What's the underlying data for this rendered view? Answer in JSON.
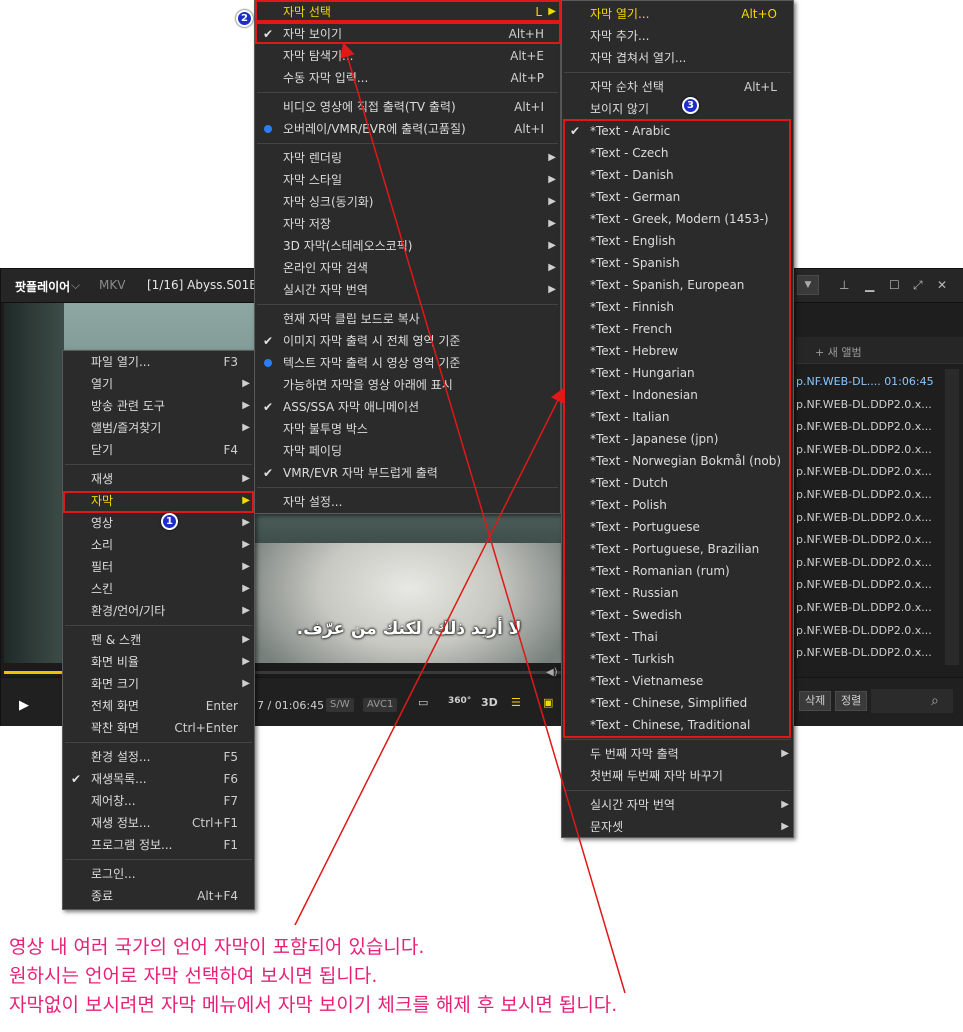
{
  "player": {
    "brand": "팟플레이어",
    "brand_chevron": "⌵",
    "format": "MKV",
    "title": "[1/16] Abyss.S01E0",
    "subtitle_text": "لا أريد ذلك، لكنك من عرّف.",
    "time": "7 / 01:06:45",
    "tags": [
      "S/W",
      "AVC1"
    ],
    "ctrl_icons": [
      "360°",
      "3D"
    ],
    "window_icons": [
      "pin-icon",
      "minimize-icon",
      "maximize-icon",
      "fullscreen-icon",
      "close-icon"
    ],
    "new_album": "+ 새 앨범",
    "playlist_rows": [
      {
        "text": "p.NF.WEB-DL.... 01:06:45",
        "active": true
      },
      {
        "text": "p.NF.WEB-DL.DDP2.0.x..."
      },
      {
        "text": "p.NF.WEB-DL.DDP2.0.x..."
      },
      {
        "text": "p.NF.WEB-DL.DDP2.0.x..."
      },
      {
        "text": "p.NF.WEB-DL.DDP2.0.x..."
      },
      {
        "text": "p.NF.WEB-DL.DDP2.0.x..."
      },
      {
        "text": "p.NF.WEB-DL.DDP2.0.x..."
      },
      {
        "text": "p.NF.WEB-DL.DDP2.0.x..."
      },
      {
        "text": "p.NF.WEB-DL.DDP2.0.x..."
      },
      {
        "text": "p.NF.WEB-DL.DDP2.0.x..."
      },
      {
        "text": "p.NF.WEB-DL.DDP2.0.x..."
      },
      {
        "text": "p.NF.WEB-DL.DDP2.0.x..."
      },
      {
        "text": "p.NF.WEB-DL.DDP2.0.x..."
      }
    ],
    "playlist_buttons": [
      "삭제",
      "정렬"
    ],
    "progress_fraction": 0.076
  },
  "menu1": {
    "items": [
      {
        "label": "파일 열기...",
        "shortcut": "F3"
      },
      {
        "label": "열기",
        "arrow": true
      },
      {
        "label": "방송 관련 도구",
        "arrow": true
      },
      {
        "label": "앨범/즐겨찾기",
        "arrow": true
      },
      {
        "label": "닫기",
        "shortcut": "F4"
      },
      {
        "sep": true
      },
      {
        "label": "재생",
        "arrow": true
      },
      {
        "label": "자막",
        "arrow": true,
        "yellow": true
      },
      {
        "label": "영상",
        "arrow": true
      },
      {
        "label": "소리",
        "arrow": true
      },
      {
        "label": "필터",
        "arrow": true
      },
      {
        "label": "스킨",
        "arrow": true
      },
      {
        "label": "환경/언어/기타",
        "arrow": true
      },
      {
        "sep": true
      },
      {
        "label": "팬 & 스캔",
        "arrow": true
      },
      {
        "label": "화면 비율",
        "arrow": true
      },
      {
        "label": "화면 크기",
        "arrow": true
      },
      {
        "label": "전체 화면",
        "shortcut": "Enter"
      },
      {
        "label": "꽉찬 화면",
        "shortcut": "Ctrl+Enter"
      },
      {
        "sep": true
      },
      {
        "label": "환경 설정...",
        "shortcut": "F5"
      },
      {
        "label": "재생목록...",
        "shortcut": "F6",
        "check": true
      },
      {
        "label": "제어창...",
        "shortcut": "F7"
      },
      {
        "label": "재생 정보...",
        "shortcut": "Ctrl+F1"
      },
      {
        "label": "프로그램 정보...",
        "shortcut": "F1"
      },
      {
        "sep": true
      },
      {
        "label": "로그인..."
      },
      {
        "label": "종료",
        "shortcut": "Alt+F4"
      }
    ]
  },
  "menu2": {
    "items": [
      {
        "label": "자막 선택",
        "shortcut": "L",
        "arrow": true,
        "yellow": true
      },
      {
        "label": "자막 보이기",
        "shortcut": "Alt+H",
        "check": true
      },
      {
        "label": "자막 탐색기...",
        "shortcut": "Alt+E"
      },
      {
        "label": "수동 자막 입력...",
        "shortcut": "Alt+P"
      },
      {
        "sep": true
      },
      {
        "label": "비디오 영상에 직접 출력(TV 출력)",
        "shortcut": "Alt+I"
      },
      {
        "label": "오버레이/VMR/EVR에 출력(고품질)",
        "shortcut": "Alt+I",
        "dot": true
      },
      {
        "sep": true
      },
      {
        "label": "자막 렌더링",
        "arrow": true
      },
      {
        "label": "자막 스타일",
        "arrow": true
      },
      {
        "label": "자막 싱크(동기화)",
        "arrow": true
      },
      {
        "label": "자막 저장",
        "arrow": true
      },
      {
        "label": "3D 자막(스테레오스코픽)",
        "arrow": true
      },
      {
        "label": "온라인 자막 검색",
        "arrow": true
      },
      {
        "label": "실시간 자막 번역",
        "arrow": true
      },
      {
        "sep": true
      },
      {
        "label": "현재 자막 클립 보드로 복사"
      },
      {
        "label": "이미지 자막 출력 시 전체 영역 기준",
        "check": true
      },
      {
        "label": "텍스트 자막 출력 시 영상 영역 기준",
        "dot": true
      },
      {
        "label": "가능하면 자막을 영상 아래에 표시"
      },
      {
        "label": "ASS/SSA 자막 애니메이션",
        "check": true
      },
      {
        "label": "자막 불투명 박스"
      },
      {
        "label": "자막 페이딩"
      },
      {
        "label": "VMR/EVR 자막 부드럽게 출력",
        "check": true
      },
      {
        "sep": true
      },
      {
        "label": "자막 설정..."
      }
    ]
  },
  "menu3": {
    "items": [
      {
        "label": "자막 열기...",
        "shortcut": "Alt+O",
        "yellow": true
      },
      {
        "label": "자막 추가..."
      },
      {
        "label": "자막 겹쳐서 열기..."
      },
      {
        "sep": true
      },
      {
        "label": "자막 순차 선택",
        "shortcut": "Alt+L"
      },
      {
        "label": "보이지 않기"
      },
      {
        "label": "*Text - Arabic",
        "check": true
      },
      {
        "label": "*Text - Czech"
      },
      {
        "label": "*Text - Danish"
      },
      {
        "label": "*Text - German"
      },
      {
        "label": "*Text - Greek, Modern (1453-)"
      },
      {
        "label": "*Text - English"
      },
      {
        "label": "*Text - Spanish"
      },
      {
        "label": "*Text - Spanish, European"
      },
      {
        "label": "*Text - Finnish"
      },
      {
        "label": "*Text - French"
      },
      {
        "label": "*Text - Hebrew"
      },
      {
        "label": "*Text - Hungarian"
      },
      {
        "label": "*Text - Indonesian"
      },
      {
        "label": "*Text - Italian"
      },
      {
        "label": "*Text - Japanese (jpn)"
      },
      {
        "label": "*Text - Norwegian Bokmål (nob)"
      },
      {
        "label": "*Text - Dutch"
      },
      {
        "label": "*Text - Polish"
      },
      {
        "label": "*Text - Portuguese"
      },
      {
        "label": "*Text - Portuguese, Brazilian"
      },
      {
        "label": "*Text - Romanian (rum)"
      },
      {
        "label": "*Text - Russian"
      },
      {
        "label": "*Text - Swedish"
      },
      {
        "label": "*Text - Thai"
      },
      {
        "label": "*Text - Turkish"
      },
      {
        "label": "*Text - Vietnamese"
      },
      {
        "label": "*Text - Chinese, Simplified"
      },
      {
        "label": "*Text - Chinese, Traditional"
      },
      {
        "sep": true
      },
      {
        "label": "두 번째 자막 출력",
        "arrow": true
      },
      {
        "label": "첫번째 두번째 자막 바꾸기"
      },
      {
        "sep": true
      },
      {
        "label": "실시간 자막 번역",
        "arrow": true
      },
      {
        "label": "문자셋",
        "arrow": true
      }
    ]
  },
  "badges": [
    "1",
    "2",
    "3"
  ],
  "annotation": {
    "lines": [
      "영상 내 여러 국가의 언어 자막이 포함되어 있습니다.",
      "원하시는 언어로 자막 선택하여 보시면 됩니다.",
      "자막없이 보시려면 자막 메뉴에서 자막 보이기 체크를 해제 후 보시면 됩니다."
    ]
  },
  "colors": {
    "accent_yellow": "#f5d800",
    "annotation_red": "#e01818",
    "annotation_text": "#e8207a",
    "badge_blue": "#1b2ec8",
    "radio_blue": "#2a7ef0"
  }
}
